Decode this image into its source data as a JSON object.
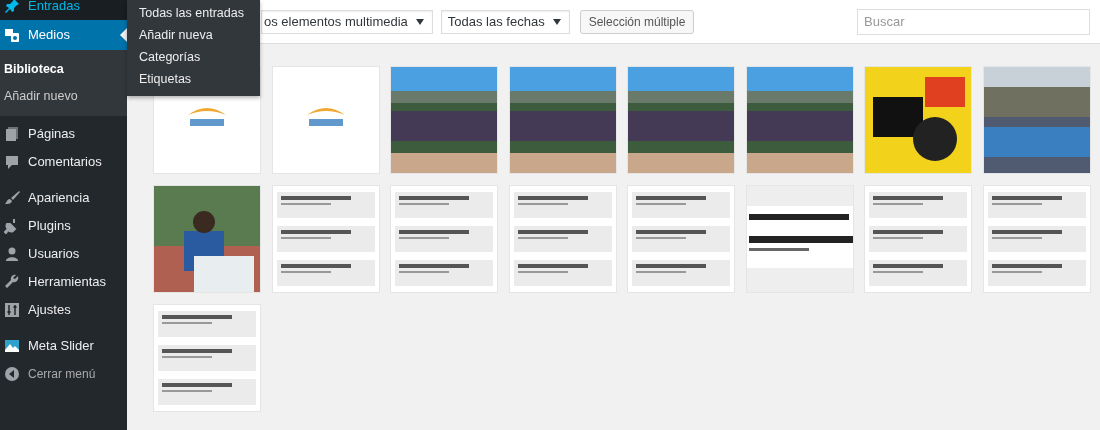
{
  "sidebar": {
    "items": [
      {
        "label": "Entradas",
        "kind": "pin",
        "selected": false,
        "hovered": true
      },
      {
        "label": "Medios",
        "kind": "media",
        "selected": true,
        "hovered": false,
        "children": [
          {
            "label": "Biblioteca",
            "selected": true
          },
          {
            "label": "Añadir nuevo",
            "selected": false
          }
        ]
      },
      {
        "label": "Páginas",
        "kind": "page",
        "selected": false,
        "hovered": false
      },
      {
        "label": "Comentarios",
        "kind": "comment",
        "selected": false,
        "hovered": false
      },
      {
        "label": "Apariencia",
        "kind": "brush",
        "selected": false,
        "hovered": false
      },
      {
        "label": "Plugins",
        "kind": "plug",
        "selected": false,
        "hovered": false
      },
      {
        "label": "Usuarios",
        "kind": "user",
        "selected": false,
        "hovered": false
      },
      {
        "label": "Herramientas",
        "kind": "wrench",
        "selected": false,
        "hovered": false
      },
      {
        "label": "Ajustes",
        "kind": "settings",
        "selected": false,
        "hovered": false
      },
      {
        "label": "Meta Slider",
        "kind": "slider",
        "selected": false,
        "hovered": false
      },
      {
        "label": "Cerrar menú",
        "kind": "collapse",
        "selected": false,
        "hovered": false
      }
    ]
  },
  "flyout_menu": {
    "items": [
      "Todas las entradas",
      "Añadir nueva",
      "Categorías",
      "Etiquetas"
    ]
  },
  "toolbar": {
    "type_filter": "os elementos multimedia",
    "date_filter": "Todas las fechas",
    "bulk_select_button": "Selección múltiple",
    "search": {
      "placeholder": "Buscar"
    }
  },
  "media": [
    {
      "kind": "logo"
    },
    {
      "kind": "logo"
    },
    {
      "kind": "crowd"
    },
    {
      "kind": "crowd"
    },
    {
      "kind": "crowd"
    },
    {
      "kind": "crowd"
    },
    {
      "kind": "poster"
    },
    {
      "kind": "street"
    },
    {
      "kind": "portrait"
    },
    {
      "kind": "document"
    },
    {
      "kind": "document"
    },
    {
      "kind": "document"
    },
    {
      "kind": "document"
    },
    {
      "kind": "banner"
    },
    {
      "kind": "document"
    },
    {
      "kind": "document"
    },
    {
      "kind": "document"
    }
  ]
}
